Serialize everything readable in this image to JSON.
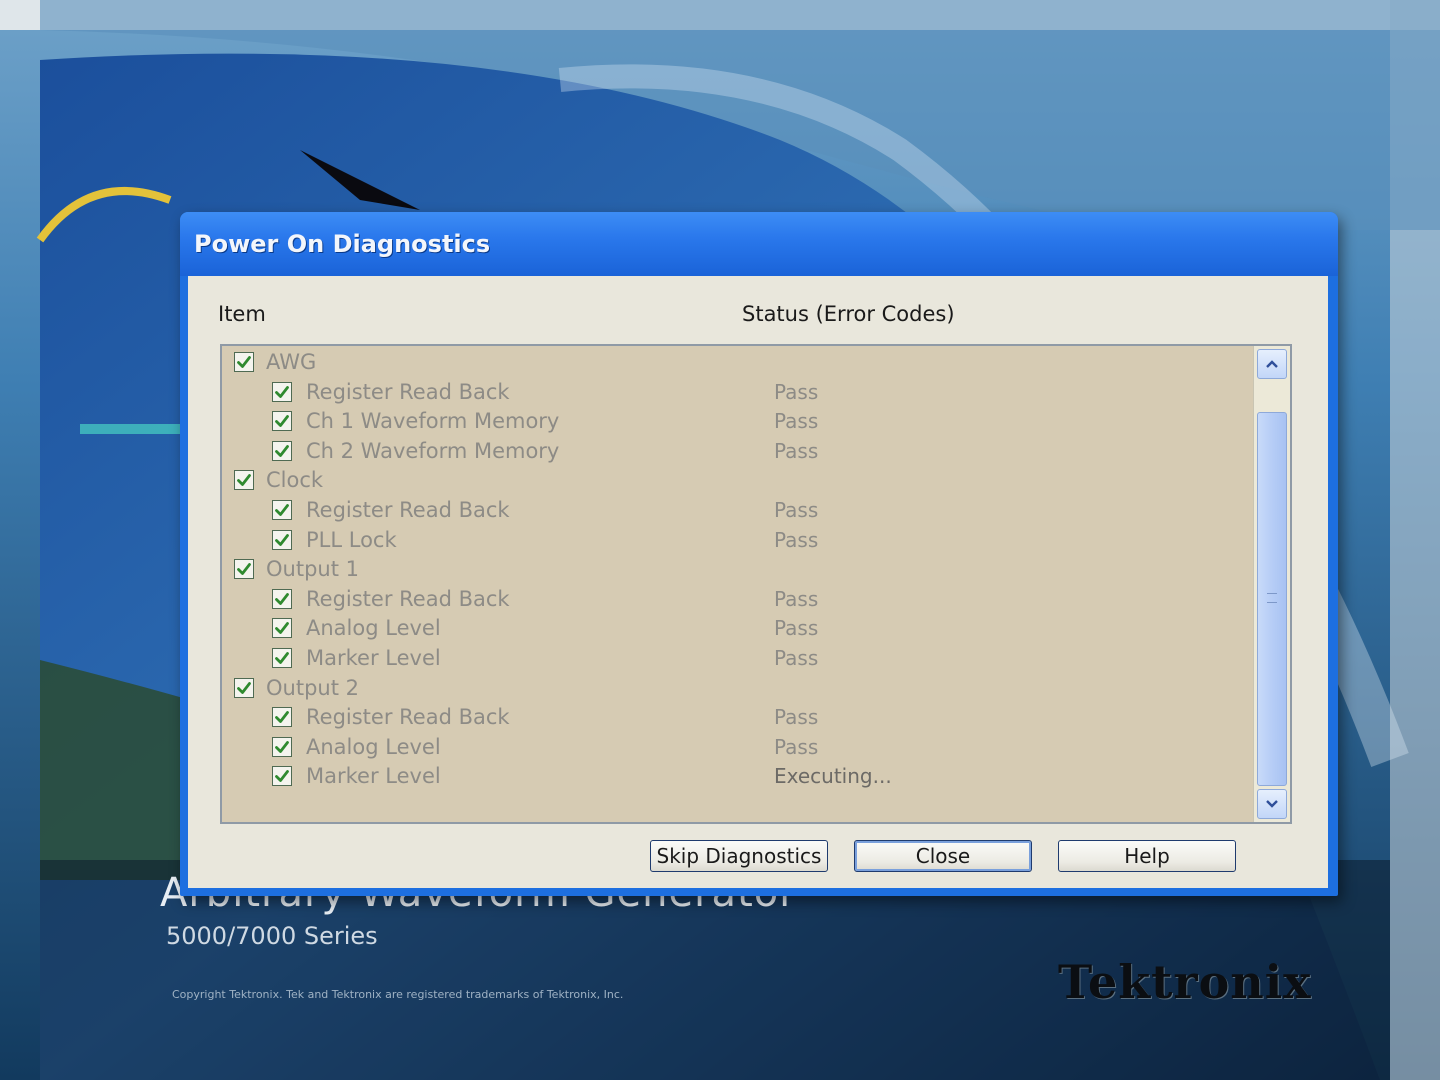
{
  "dialog": {
    "title": "Power On Diagnostics",
    "columns": {
      "item": "Item",
      "status": "Status (Error Codes)"
    },
    "rows": [
      {
        "label": "AWG",
        "level": 0,
        "checked": true,
        "status": ""
      },
      {
        "label": "Register Read Back",
        "level": 1,
        "checked": true,
        "status": "Pass"
      },
      {
        "label": "Ch 1 Waveform Memory",
        "level": 1,
        "checked": true,
        "status": "Pass"
      },
      {
        "label": "Ch 2 Waveform Memory",
        "level": 1,
        "checked": true,
        "status": "Pass"
      },
      {
        "label": "Clock",
        "level": 0,
        "checked": true,
        "status": ""
      },
      {
        "label": "Register Read Back",
        "level": 1,
        "checked": true,
        "status": "Pass"
      },
      {
        "label": "PLL Lock",
        "level": 1,
        "checked": true,
        "status": "Pass"
      },
      {
        "label": "Output 1",
        "level": 0,
        "checked": true,
        "status": ""
      },
      {
        "label": "Register Read Back",
        "level": 1,
        "checked": true,
        "status": "Pass"
      },
      {
        "label": "Analog Level",
        "level": 1,
        "checked": true,
        "status": "Pass"
      },
      {
        "label": "Marker Level",
        "level": 1,
        "checked": true,
        "status": "Pass"
      },
      {
        "label": "Output 2",
        "level": 0,
        "checked": true,
        "status": ""
      },
      {
        "label": "Register Read Back",
        "level": 1,
        "checked": true,
        "status": "Pass"
      },
      {
        "label": "Analog Level",
        "level": 1,
        "checked": true,
        "status": "Pass"
      },
      {
        "label": "Marker Level",
        "level": 1,
        "checked": true,
        "status": "Executing..."
      }
    ],
    "buttons": {
      "skip": "Skip Diagnostics",
      "close": "Close",
      "help": "Help"
    }
  },
  "splash": {
    "title": "Arbitrary Waveform Generator",
    "series": "5000/7000 Series",
    "copyright": "Copyright Tektronix. Tek and Tektronix are registered trademarks of Tektronix, Inc.",
    "brand": "Tektronix"
  },
  "icons": {
    "checkbox": "checkmark-icon",
    "scroll_up": "chevron-up-icon",
    "scroll_down": "chevron-down-icon"
  },
  "colors": {
    "titlebar": "#2a78ec",
    "client_bg": "#e9e7dc",
    "list_bg": "#d6cbb3",
    "check_green": "#2f8a2f"
  }
}
